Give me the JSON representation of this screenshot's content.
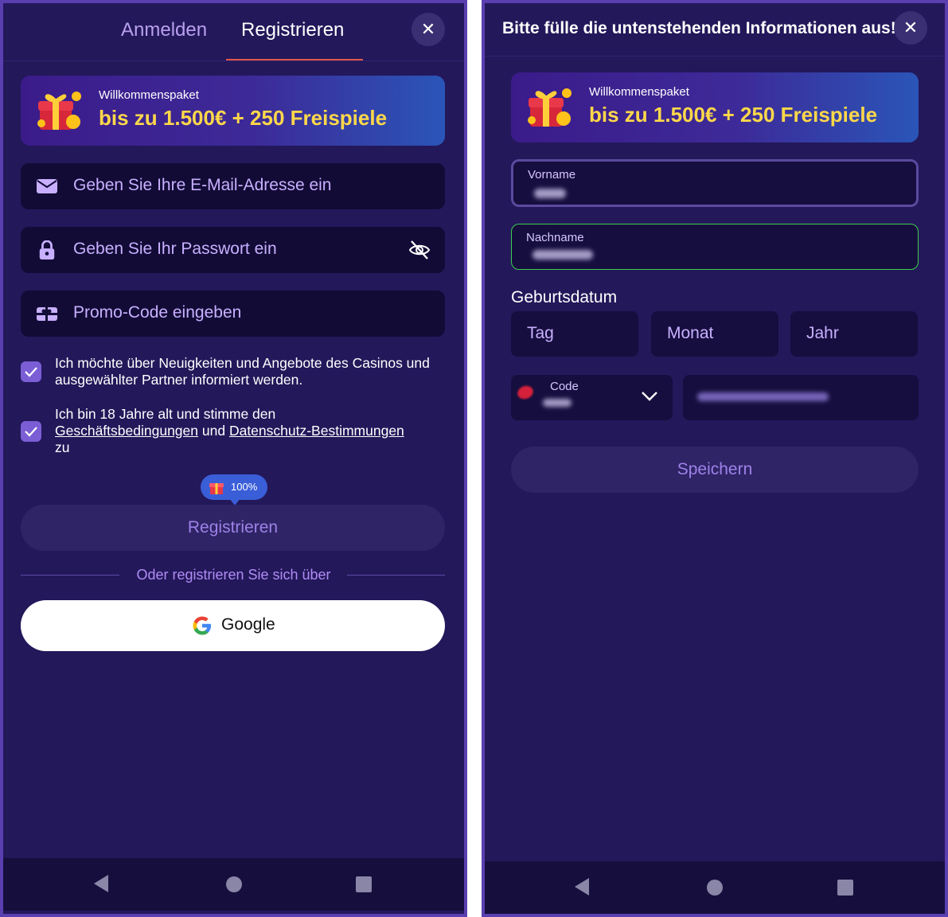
{
  "left": {
    "tabs": {
      "login": "Anmelden",
      "register": "Registrieren"
    },
    "close_icon": "close-icon",
    "banner": {
      "subtitle": "Willkommenspaket",
      "headline": "bis zu 1.500€ + 250 Freispiele"
    },
    "fields": {
      "email_placeholder": "Geben Sie Ihre E-Mail-Adresse ein",
      "password_placeholder": "Geben Sie Ihr Passwort ein",
      "promo_placeholder": "Promo-Code eingeben"
    },
    "checkboxes": {
      "news": "Ich möchte über Neuigkeiten und Angebote des Casinos und ausgewählter Partner informiert werden.",
      "age_prefix": "Ich bin 18 Jahre alt und stimme den",
      "terms_link": "Geschäftsbedingungen",
      "and": "und",
      "privacy_link": "Datenschutz-Bestimmungen",
      "suffix": "zu"
    },
    "badge": "100%",
    "register_button": "Registrieren",
    "or_text": "Oder registrieren Sie sich über",
    "google_button": "Google"
  },
  "right": {
    "title": "Bitte fülle die untenstehenden Informationen aus!",
    "banner": {
      "subtitle": "Willkommenspaket",
      "headline": "bis zu 1.500€ + 250 Freispiele"
    },
    "first_name_label": "Vorname",
    "last_name_label": "Nachname",
    "birthdate_label": "Geburtsdatum",
    "day": "Tag",
    "month": "Monat",
    "year": "Jahr",
    "code_label": "Code",
    "save_button": "Speichern"
  },
  "colors": {
    "background": "#23185a",
    "field": "#120b36",
    "accent": "#b08cf5",
    "banner_text": "#ffd84a",
    "valid_border": "#3ccf4e"
  }
}
